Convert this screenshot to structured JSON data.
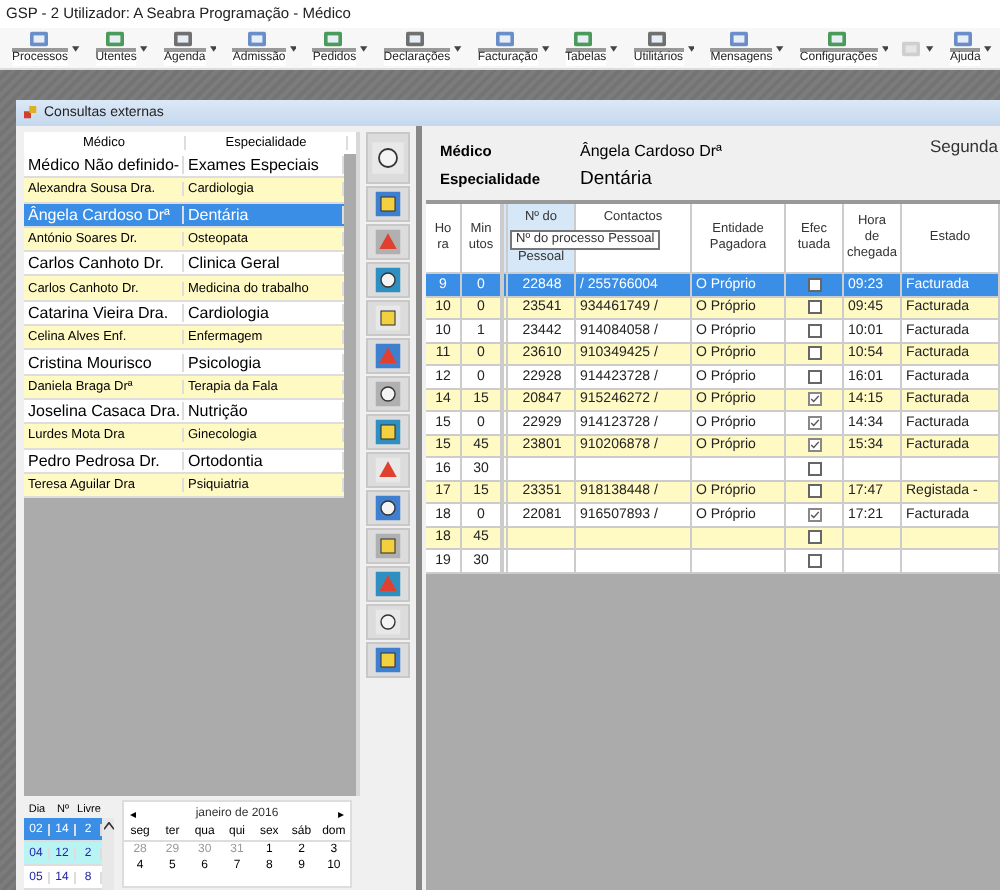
{
  "window": {
    "title": "GSP - 2 Utilizador: A Seabra Programação  - Médico"
  },
  "toolbar": [
    {
      "kind": "labeled",
      "label": "Processos",
      "disabled": false
    },
    {
      "kind": "labeled",
      "label": "Utentes",
      "disabled": false
    },
    {
      "kind": "labeled",
      "label": "Agenda",
      "disabled": false
    },
    {
      "kind": "labeled",
      "label": "Admissão",
      "disabled": false
    },
    {
      "kind": "labeled",
      "label": "Pedidos",
      "disabled": false
    },
    {
      "kind": "labeled",
      "label": "Declarações",
      "disabled": false
    },
    {
      "kind": "labeled",
      "label": "Facturação",
      "disabled": false
    },
    {
      "kind": "labeled",
      "label": "Tabelas",
      "disabled": false
    },
    {
      "kind": "labeled",
      "label": "Utilitários",
      "disabled": false
    },
    {
      "kind": "labeled",
      "label": "Mensagens",
      "disabled": false
    },
    {
      "kind": "labeled",
      "label": "Configurações",
      "disabled": false
    },
    {
      "kind": "icon",
      "disabled": true
    },
    {
      "kind": "labeled",
      "label": "Ajuda",
      "disabled": false
    }
  ],
  "child_window": {
    "title": "Consultas externas"
  },
  "doctors": {
    "columns": [
      "Médico",
      "Especialidade"
    ],
    "rows": [
      {
        "name": "Médico Não definido-",
        "specialty": "Exames Especiais",
        "selected": false
      },
      {
        "name": "Alexandra Sousa Dra.",
        "specialty": "Cardiologia",
        "selected": false
      },
      {
        "name": "Ângela Cardoso Drª",
        "specialty": "Dentária",
        "selected": true
      },
      {
        "name": "António Soares Dr.",
        "specialty": "Osteopata",
        "selected": false
      },
      {
        "name": "Carlos Canhoto Dr.",
        "specialty": "Clinica Geral",
        "selected": false
      },
      {
        "name": "Carlos Canhoto Dr.",
        "specialty": "Medicina do trabalho",
        "selected": false
      },
      {
        "name": "Catarina Vieira Dra.",
        "specialty": "Cardiologia",
        "selected": false
      },
      {
        "name": "Celina Alves Enf.",
        "specialty": "Enfermagem",
        "selected": false
      },
      {
        "name": "Cristina Mourisco",
        "specialty": "Psicologia",
        "selected": false
      },
      {
        "name": "Daniela Braga Drª",
        "specialty": "Terapia da Fala",
        "selected": false
      },
      {
        "name": "Joselina Casaca Dra.",
        "specialty": "Nutrição",
        "selected": false
      },
      {
        "name": "Lurdes Mota Dra",
        "specialty": "Ginecologia",
        "selected": false
      },
      {
        "name": "Pedro Pedrosa Dr.",
        "specialty": "Ortodontia",
        "selected": false
      },
      {
        "name": "Teresa Aguilar Dra",
        "specialty": "Psiquiatria",
        "selected": false
      }
    ]
  },
  "availability": {
    "columns": [
      "Dia",
      "Nº",
      "Livre"
    ],
    "rows": [
      {
        "dia": "02",
        "n": "14",
        "livre": "2",
        "selected": true,
        "highlighted": false
      },
      {
        "dia": "04",
        "n": "12",
        "livre": "2",
        "selected": false,
        "highlighted": true
      },
      {
        "dia": "05",
        "n": "14",
        "livre": "8",
        "selected": false,
        "highlighted": false
      }
    ]
  },
  "calendar": {
    "prev": "◂",
    "month": "janeiro de 2016",
    "next": "▸",
    "weekdays": [
      "seg",
      "ter",
      "qua",
      "qui",
      "sex",
      "sáb",
      "dom"
    ],
    "weeks": [
      [
        {
          "day": "28",
          "other_month": true
        },
        {
          "day": "29",
          "other_month": true
        },
        {
          "day": "30",
          "other_month": true
        },
        {
          "day": "31",
          "other_month": true
        },
        {
          "day": "1",
          "other_month": false
        },
        {
          "day": "2",
          "other_month": false
        },
        {
          "day": "3",
          "other_month": false
        }
      ],
      [
        {
          "day": "4",
          "other_month": false
        },
        {
          "day": "5",
          "other_month": false
        },
        {
          "day": "6",
          "other_month": false
        },
        {
          "day": "7",
          "other_month": false
        },
        {
          "day": "8",
          "other_month": false
        },
        {
          "day": "9",
          "other_month": false
        },
        {
          "day": "10",
          "other_month": false
        }
      ]
    ]
  },
  "info": {
    "medico_label": "Médico",
    "medico": "Ângela Cardoso Drª",
    "especialidade_label": "Especialidade",
    "especialidade": "Dentária",
    "day": "Segunda"
  },
  "appointments": {
    "columns": [
      {
        "label": "Ho\nra",
        "highlighted": false
      },
      {
        "label": "Min\nutos",
        "highlighted": false
      },
      {
        "label": "Nº do\n\nPessoal",
        "highlighted": true
      },
      {
        "label": "Contactos",
        "highlighted": false
      },
      {
        "label": "Entidade\nPagadora",
        "highlighted": false
      },
      {
        "label": "Efec\ntuada",
        "highlighted": false
      },
      {
        "label": "Hora\nde\nchegada",
        "highlighted": false
      },
      {
        "label": "Estado",
        "highlighted": false
      }
    ],
    "tooltip": "Nº do processo Pessoal",
    "rows": [
      {
        "hora": "9",
        "min": "0",
        "num": "22848",
        "contact": "/ 255766004",
        "entity": "O Próprio",
        "done": false,
        "arrival": "09:23",
        "status": "Facturada",
        "selected": true
      },
      {
        "hora": "10",
        "min": "0",
        "num": "23541",
        "contact": "934461749 /",
        "entity": "O Próprio",
        "done": false,
        "arrival": "09:45",
        "status": "Facturada",
        "selected": false
      },
      {
        "hora": "10",
        "min": "1",
        "num": "23442",
        "contact": "914084058 /",
        "entity": "O Próprio",
        "done": false,
        "arrival": "10:01",
        "status": "Facturada",
        "selected": false
      },
      {
        "hora": "11",
        "min": "0",
        "num": "23610",
        "contact": "910349425 /",
        "entity": "O Próprio",
        "done": false,
        "arrival": "10:54",
        "status": "Facturada",
        "selected": false
      },
      {
        "hora": "12",
        "min": "0",
        "num": "22928",
        "contact": "914423728 /",
        "entity": "O Próprio",
        "done": false,
        "arrival": "16:01",
        "status": "Facturada",
        "selected": false
      },
      {
        "hora": "14",
        "min": "15",
        "num": "20847",
        "contact": "915246272 /",
        "entity": "O Próprio",
        "done": true,
        "arrival": "14:15",
        "status": "Facturada",
        "selected": false
      },
      {
        "hora": "15",
        "min": "0",
        "num": "22929",
        "contact": "914123728 /",
        "entity": "O Próprio",
        "done": true,
        "arrival": "14:34",
        "status": "Facturada",
        "selected": false
      },
      {
        "hora": "15",
        "min": "45",
        "num": "23801",
        "contact": "910206878 /",
        "entity": "O Próprio",
        "done": true,
        "arrival": "15:34",
        "status": "Facturada",
        "selected": false
      },
      {
        "hora": "16",
        "min": "30",
        "done": false,
        "selected": false
      },
      {
        "hora": "17",
        "min": "15",
        "num": "23351",
        "contact": "918138448 /",
        "entity": "O Próprio",
        "done": false,
        "arrival": "17:47",
        "status": "Registada -",
        "selected": false
      },
      {
        "hora": "18",
        "min": "0",
        "num": "22081",
        "contact": "916507893 /",
        "entity": "O Próprio",
        "done": true,
        "arrival": "17:21",
        "status": "Facturada",
        "selected": false
      },
      {
        "hora": "18",
        "min": "45",
        "done": false,
        "selected": false
      },
      {
        "hora": "19",
        "min": "30",
        "done": false,
        "selected": false
      }
    ]
  }
}
